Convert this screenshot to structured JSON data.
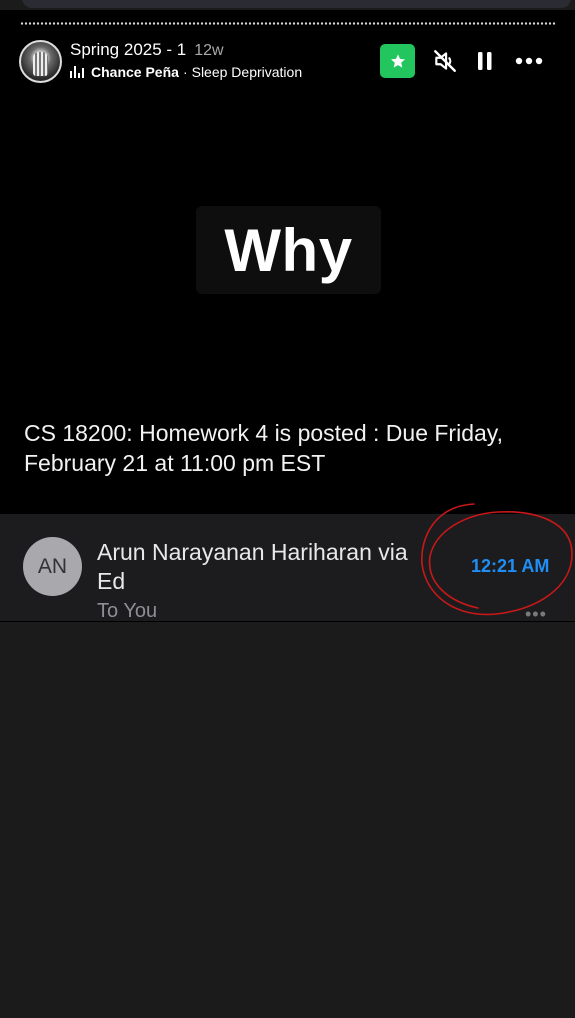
{
  "story": {
    "title": "Spring 2025 - 1",
    "age": "12w",
    "music": {
      "artist": "Chance Peña",
      "separator": "·",
      "song": "Sleep Deprivation"
    },
    "controls": {
      "star_color": "#22c55e"
    }
  },
  "sticker": {
    "text": "Why"
  },
  "email": {
    "subject": "CS 18200: Homework 4 is posted : Due Friday, February 21 at 11:00 pm EST",
    "avatar_initials": "AN",
    "sender": "Arun Narayanan Hariharan via Ed",
    "recipient": "To You",
    "time": "12:21 AM",
    "time_color": "#1f8ef5",
    "more": "•••"
  },
  "annotation": {
    "color": "#d01818"
  }
}
